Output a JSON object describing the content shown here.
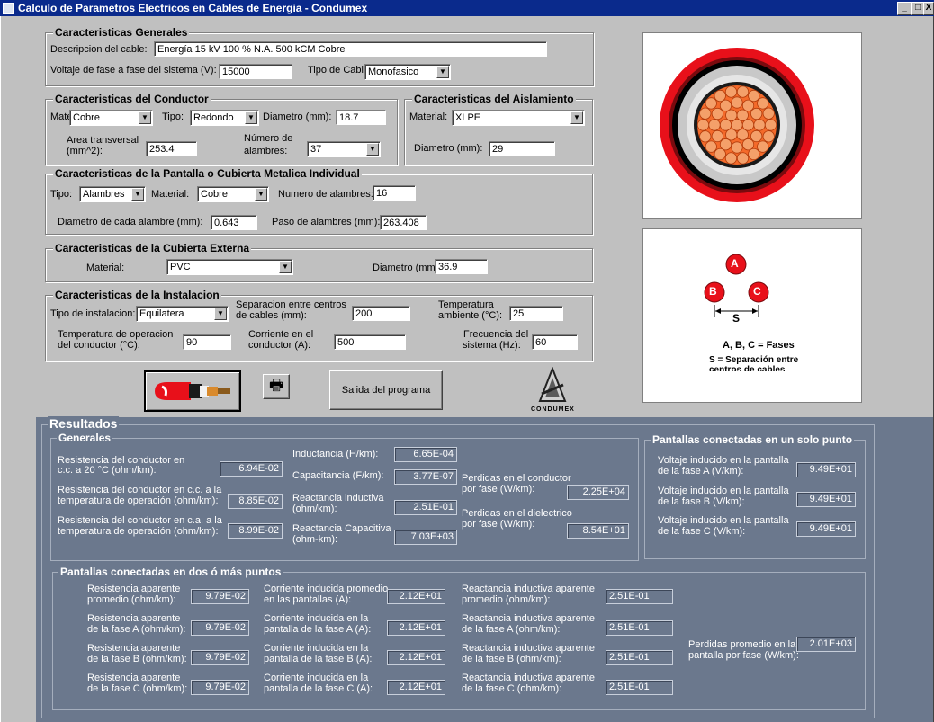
{
  "window": {
    "title": "Calculo de Parametros Electricos en Cables de Energia - Condumex",
    "min": "_",
    "max": "□",
    "close": "X"
  },
  "general": {
    "title": "Caracteristicas Generales",
    "desc_label": "Descripcion del cable:",
    "desc_value": "Energía 15 kV 100 % N.A. 500 kCM Cobre",
    "voltage_label": "Voltaje de fase a fase del sistema (V):",
    "voltage_value": "15000",
    "cabletype_label": "Tipo de Cable:",
    "cabletype_value": "Monofasico"
  },
  "conductor": {
    "title": "Caracteristicas del Conductor",
    "material_label": "Material:",
    "material_value": "Cobre",
    "tipo_label": "Tipo:",
    "tipo_value": "Redondo",
    "diam_label": "Diametro (mm):",
    "diam_value": "18.7",
    "area_label_1": "Area transversal",
    "area_label_2": "(mm^2):",
    "area_value": "253.4",
    "wires_label_1": "Número de",
    "wires_label_2": "alambres:",
    "wires_value": "37"
  },
  "insulation": {
    "title": "Caracteristicas del Aislamiento",
    "material_label": "Material:",
    "material_value": "XLPE",
    "diam_label": "Diametro (mm):",
    "diam_value": "29"
  },
  "screen": {
    "title": "Caracteristicas de la Pantalla o Cubierta Metalica Individual",
    "tipo_label": "Tipo:",
    "tipo_value": "Alambres",
    "material_label": "Material:",
    "material_value": "Cobre",
    "nwires_label": "Numero de alambres:",
    "nwires_value": "16",
    "wdiam_label": "Diametro de cada alambre (mm):",
    "wdiam_value": "0.643",
    "pitch_label": "Paso de alambres (mm):",
    "pitch_value": "263.408"
  },
  "jacket": {
    "title": "Caracteristicas de la Cubierta Externa",
    "material_label": "Material:",
    "material_value": "PVC",
    "diam_label": "Diametro (mm):",
    "diam_value": "36.9"
  },
  "installation": {
    "title": "Caracteristicas de la Instalacion",
    "tipo_label": "Tipo de instalacion:",
    "tipo_value": "Equilatera",
    "sep_label_1": "Separacion entre centros",
    "sep_label_2": "de cables (mm):",
    "sep_value": "200",
    "temp_label_1": "Temperatura",
    "temp_label_2": "ambiente (°C):",
    "temp_value": "25",
    "optemp_label_1": "Temperatura de operacion",
    "optemp_label_2": "del conductor (°C):",
    "optemp_value": "90",
    "current_label_1": "Corriente en el",
    "current_label_2": "conductor (A):",
    "current_value": "500",
    "freq_label_1": "Frecuencia del",
    "freq_label_2": "sistema (Hz):",
    "freq_value": "60"
  },
  "buttons": {
    "exit": "Salida del programa",
    "logo_text": "CONDUMEX"
  },
  "diagram": {
    "a": "A",
    "b": "B",
    "c": "C",
    "s": "S",
    "legend1": "A, B, C = Fases",
    "legend2": "S = Separación entre",
    "legend3": "centros de cables"
  },
  "results": {
    "title": "Resultados",
    "general_title": "Generales",
    "r20_label_1": "Resistencia del conductor en",
    "r20_label_2": "c.c. a 20 °C (ohm/km):",
    "r20_value": "6.94E-02",
    "rcc_label_1": "Resistencia del conductor en c.c. a la",
    "rcc_label_2": "temperatura de operación (ohm/km):",
    "rcc_value": "8.85E-02",
    "rca_label_1": "Resistencia del conductor en c.a. a la",
    "rca_label_2": "temperatura de operación (ohm/km):",
    "rca_value": "8.99E-02",
    "ind_label": "Inductancia (H/km):",
    "ind_value": "6.65E-04",
    "cap_label": "Capacitancia (F/km):",
    "cap_value": "3.77E-07",
    "xl_label_1": "Reactancia inductiva",
    "xl_label_2": "(ohm/km):",
    "xl_value": "2.51E-01",
    "xc_label_1": "Reactancia Capacitiva",
    "xc_label_2": "(ohm-km):",
    "xc_value": "7.03E+03",
    "pc_label_1": "Perdidas en el conductor",
    "pc_label_2": "por fase (W/km):",
    "pc_value": "2.25E+04",
    "pd_label_1": "Perdidas en el dielectrico",
    "pd_label_2": "por fase (W/km):",
    "pd_value": "8.54E+01",
    "single_title": "Pantallas conectadas en un solo punto",
    "va_label_1": "Voltaje inducido en la pantalla",
    "va_label_2": "de la fase A (V/km):",
    "va_value": "9.49E+01",
    "vb_label_1": "Voltaje inducido en la pantalla",
    "vb_label_2": "de la fase B (V/km):",
    "vb_value": "9.49E+01",
    "vc_label_1": "Voltaje inducido en la pantalla",
    "vc_label_2": "de la fase C (V/km):",
    "vc_value": "9.49E+01",
    "multi_title": "Pantallas conectadas en dos ó más puntos",
    "multi": {
      "rows": [
        {
          "r_label_1": "Resistencia aparente",
          "r_label_2": "promedio (ohm/km):",
          "r_value": "9.79E-02",
          "i_label_1": "Corriente inducida promedio",
          "i_label_2": "en las pantallas (A):",
          "i_value": "2.12E+01",
          "x_label_1": "Reactancia inductiva aparente",
          "x_label_2": "promedio (ohm/km):",
          "x_value": "2.51E-01"
        },
        {
          "r_label_1": "Resistencia aparente",
          "r_label_2": "de la fase A (ohm/km):",
          "r_value": "9.79E-02",
          "i_label_1": "Corriente inducida en la",
          "i_label_2": "pantalla de la fase A (A):",
          "i_value": "2.12E+01",
          "x_label_1": "Reactancia inductiva aparente",
          "x_label_2": "de la fase A (ohm/km):",
          "x_value": "2.51E-01"
        },
        {
          "r_label_1": "Resistencia aparente",
          "r_label_2": "de la fase B (ohm/km):",
          "r_value": "9.79E-02",
          "i_label_1": "Corriente inducida en la",
          "i_label_2": "pantalla de la fase B (A):",
          "i_value": "2.12E+01",
          "x_label_1": "Reactancia inductiva aparente",
          "x_label_2": "de la fase B (ohm/km):",
          "x_value": "2.51E-01"
        },
        {
          "r_label_1": "Resistencia aparente",
          "r_label_2": "de la fase C (ohm/km):",
          "r_value": "9.79E-02",
          "i_label_1": "Corriente inducida en la",
          "i_label_2": "pantalla de la fase C (A):",
          "i_value": "2.12E+01",
          "x_label_1": "Reactancia inductiva aparente",
          "x_label_2": "de la fase C (ohm/km):",
          "x_value": "2.51E-01"
        }
      ],
      "ploss_label_1": "Perdidas promedio en la",
      "ploss_label_2": "pantalla por fase (W/km):",
      "ploss_value": "2.01E+03"
    }
  },
  "colors": {
    "titlebar": "#0a2a8c",
    "panel": "#c0c0c0",
    "results_bg": "#6b788d",
    "phase_red": "#e8101a",
    "cable_core": "#f2541a"
  }
}
